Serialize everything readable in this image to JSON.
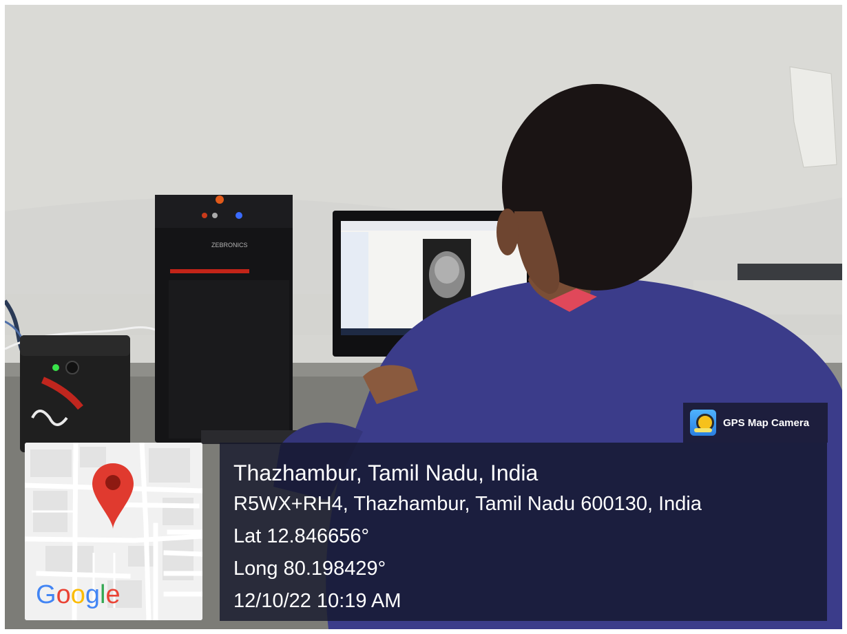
{
  "overlay": {
    "app_badge": "GPS Map Camera",
    "location_title": "Thazhambur, Tamil Nadu, India",
    "address": "R5WX+RH4, Thazhambur, Tamil Nadu 600130, India",
    "latitude": "Lat 12.846656°",
    "longitude": "Long 80.198429°",
    "timestamp": "12/10/22 10:19 AM"
  },
  "map": {
    "logo_letters": [
      "G",
      "o",
      "o",
      "g",
      "l",
      "e"
    ],
    "logo_colors": [
      "#4285F4",
      "#EA4335",
      "#FBBC05",
      "#4285F4",
      "#34A853",
      "#EA4335"
    ],
    "pin_color": "#E03A2F"
  },
  "photo_text": {
    "cpu_brand": "ZEBRONICS"
  }
}
